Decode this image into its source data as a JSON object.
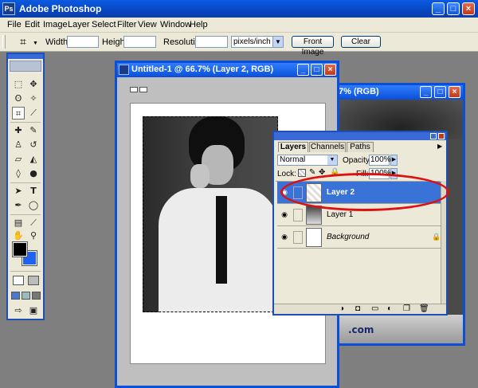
{
  "app": {
    "title": "Adobe Photoshop"
  },
  "menu": [
    "File",
    "Edit",
    "Image",
    "Layer",
    "Select",
    "Filter",
    "View",
    "Window",
    "Help"
  ],
  "options": {
    "width_label": "Width:",
    "height_label": "Height:",
    "resolution_label": "Resolution:",
    "units": "pixels/inch",
    "front_image": "Front Image",
    "clear": "Clear"
  },
  "document_front": {
    "title": "Untitled-1 @ 66.7% (Layer 2, RGB)"
  },
  "document_back": {
    "title_fragment": "7% (RGB)",
    "bottom_text": ".com"
  },
  "layers_panel": {
    "tabs": [
      "Layers",
      "Channels",
      "Paths"
    ],
    "blend_mode": "Normal",
    "opacity_label": "Opacity:",
    "opacity_value": "100%",
    "lock_label": "Lock:",
    "fill_label": "Fill:",
    "fill_value": "100%",
    "layers": [
      {
        "name": "Layer 2",
        "selected": true
      },
      {
        "name": "Layer 1",
        "selected": false
      },
      {
        "name": "Background",
        "selected": false,
        "locked": true
      }
    ]
  },
  "colors": {
    "accent": "#0a4fd6",
    "selection": "#3a73d8",
    "annotation_ring": "#dd1111",
    "foreground_color": "#000000",
    "background_color": "#1f64f0"
  }
}
